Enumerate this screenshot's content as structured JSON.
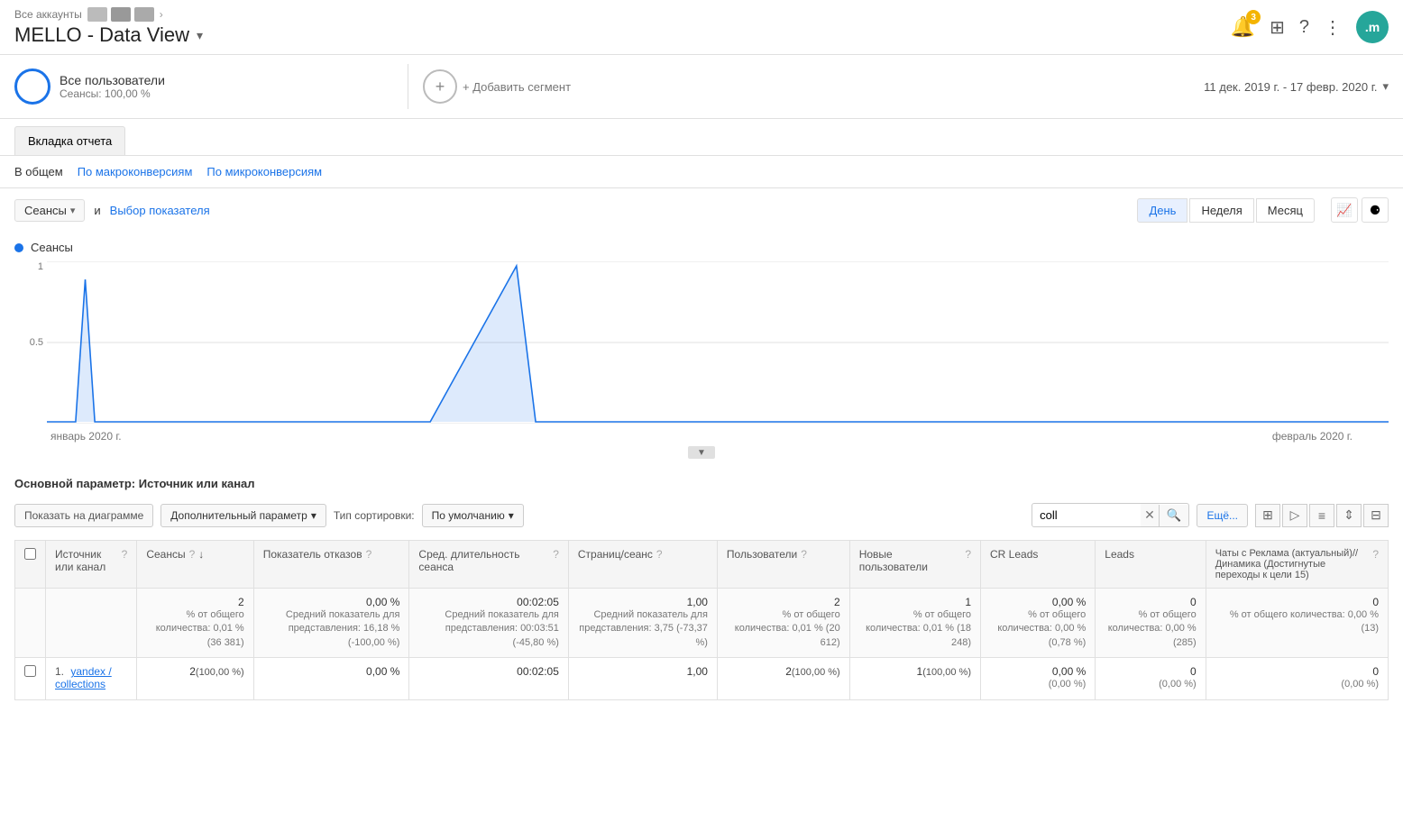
{
  "header": {
    "breadcrumb": "Все аккаунты",
    "title": "MELLO - Data View",
    "title_dropdown": "▾",
    "bell_badge": "3",
    "avatar_text": ".m"
  },
  "segment": {
    "all_users_label": "Все пользователи",
    "sessions_label": "Сеансы: 100,00 %",
    "add_segment_label": "+ Добавить сегмент",
    "date_range": "11 дек. 2019 г. - 17 февр. 2020 г."
  },
  "report_tab": {
    "tab_label": "Вкладка отчета"
  },
  "sub_tabs": [
    {
      "label": "В общем",
      "active": true
    },
    {
      "label": "По макроконверсиям",
      "active": false
    },
    {
      "label": "По микроконверсиям",
      "active": false
    }
  ],
  "chart_controls": {
    "metric_btn": "Сеансы",
    "and_text": "и",
    "select_metric": "Выбор показателя",
    "view_btns": [
      "День",
      "Неделя",
      "Месяц"
    ],
    "active_view": "День"
  },
  "chart": {
    "legend_label": "Сеансы",
    "y_labels": [
      "1",
      "0.5"
    ],
    "x_labels": [
      "январь 2020 г.",
      "февраль 2020 г."
    ]
  },
  "table_section": {
    "primary_param_label": "Основной параметр:",
    "primary_param_value": "Источник или канал",
    "show_chart_btn": "Показать на диаграмме",
    "extra_param_btn": "Дополнительный параметр",
    "sort_type_label": "Тип сортировки:",
    "sort_type_value": "По умолчанию",
    "search_value": "coll",
    "more_btn": "Ещё...",
    "columns": [
      {
        "key": "source",
        "label": "Источник или канал",
        "help": true,
        "sortable": false
      },
      {
        "key": "sessions",
        "label": "Сеансы",
        "help": true,
        "sortable": true
      },
      {
        "key": "bounce_rate",
        "label": "Показатель отказов",
        "help": true
      },
      {
        "key": "avg_duration",
        "label": "Сред. длительность сеанса",
        "help": true
      },
      {
        "key": "pages_per_session",
        "label": "Страниц/сеанс",
        "help": true
      },
      {
        "key": "users",
        "label": "Пользователи",
        "help": true
      },
      {
        "key": "new_users",
        "label": "Новые пользователи",
        "help": true
      },
      {
        "key": "cr_leads",
        "label": "CR Leads",
        "help": false
      },
      {
        "key": "leads",
        "label": "Leads",
        "help": false
      },
      {
        "key": "chats",
        "label": "Чаты с Реклама (актуальный)// Динамика (Достигнутые переходы к цели 15)",
        "help": true
      }
    ],
    "total_row": {
      "source": "",
      "sessions": "2",
      "sessions_sub": "% от общего количества: 0,01 % (36 381)",
      "bounce_rate": "0,00 %",
      "bounce_rate_sub": "Средний показатель для представления: 16,18 % (-100,00 %)",
      "avg_duration": "00:02:05",
      "avg_duration_sub": "Средний показатель для представления: 00:03:51 (-45,80 %)",
      "pages_per_session": "1,00",
      "pages_per_session_sub": "Средний показатель для представления: 3,75 (-73,37 %)",
      "users": "2",
      "users_sub": "% от общего количества: 0,01 % (20 612)",
      "new_users": "1",
      "new_users_sub": "% от общего количества: 0,01 % (18 248)",
      "cr_leads": "0,00 %",
      "cr_leads_sub": "% от общего количества: 0,00 % (0,78 %)",
      "leads": "0",
      "leads_sub": "% от общего количества: 0,00 % (285)",
      "chats": "0",
      "chats_sub": "% от общего количества: 0,00 % (13)"
    },
    "rows": [
      {
        "num": "1.",
        "source": "yandex / collections",
        "sessions": "2(100,00 %)",
        "bounce_rate": "0,00 %",
        "avg_duration": "00:02:05",
        "pages_per_session": "1,00",
        "users": "2(100,00 %)",
        "new_users": "1(100,00 %)",
        "cr_leads": "0,00 %",
        "cr_leads_sub": "(0,00 %)",
        "leads": "0",
        "leads_sub": "(0,00 %)",
        "chats": "0",
        "chats_sub": "(0,00 %)"
      }
    ]
  }
}
